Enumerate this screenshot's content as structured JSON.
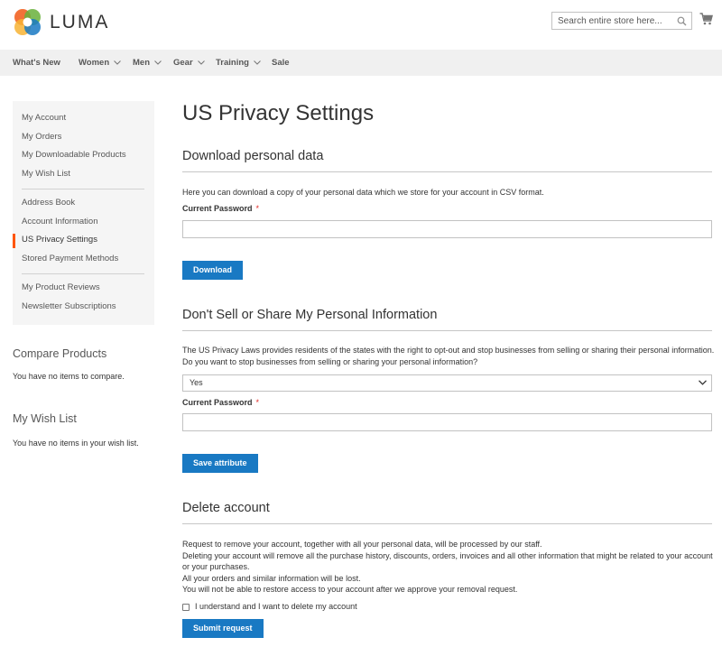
{
  "header": {
    "logo_text": "LUMA",
    "search_placeholder": "Search entire store here...",
    "colors": {
      "logo_orange": "#f26322",
      "logo_green": "#69b03b",
      "logo_blue": "#1979c3",
      "logo_yellow": "#f7b334"
    }
  },
  "nav": {
    "items": [
      {
        "label": "What's New",
        "has_menu": false
      },
      {
        "label": "Women",
        "has_menu": true
      },
      {
        "label": "Men",
        "has_menu": true
      },
      {
        "label": "Gear",
        "has_menu": true
      },
      {
        "label": "Training",
        "has_menu": true
      },
      {
        "label": "Sale",
        "has_menu": false
      }
    ]
  },
  "sidebar": {
    "items": [
      {
        "label": "My Account"
      },
      {
        "label": "My Orders"
      },
      {
        "label": "My Downloadable Products"
      },
      {
        "label": "My Wish List"
      },
      {
        "label": "Address Book"
      },
      {
        "label": "Account Information"
      },
      {
        "label": "US Privacy Settings",
        "active": true
      },
      {
        "label": "Stored Payment Methods"
      },
      {
        "label": "My Product Reviews"
      },
      {
        "label": "Newsletter Subscriptions"
      }
    ],
    "active_color": "#ff5501"
  },
  "compare": {
    "title": "Compare Products",
    "empty_text": "You have no items to compare."
  },
  "wishlist": {
    "title": "My Wish List",
    "empty_text": "You have no items in your wish list."
  },
  "main": {
    "title": "US Privacy Settings",
    "download": {
      "title": "Download personal data",
      "text": "Here you can download a copy of your personal data which we store for your account in CSV format.",
      "password_label": "Current Password",
      "required_mark": "*",
      "button": "Download"
    },
    "dont_sell": {
      "title": "Don't Sell or Share My Personal Information",
      "text": "The US Privacy Laws provides residents of the states with the right to opt-out and stop businesses from selling or sharing their personal information. Do you want to stop businesses from selling or sharing your personal information?",
      "select_value": "Yes",
      "password_label": "Current Password",
      "required_mark": "*",
      "button": "Save attribute"
    },
    "delete": {
      "title": "Delete account",
      "lines": [
        "Request to remove your account, together with all your personal data, will be processed by our staff.",
        "Deleting your account will remove all the purchase history, discounts, orders, invoices and all other information that might be related to your account or your purchases.",
        "All your orders and similar information will be lost.",
        "You will not be able to restore access to your account after we approve your removal request."
      ],
      "checkbox_label": "I understand and I want to delete my account",
      "button": "Submit request"
    },
    "button_color": "#1979c3"
  }
}
